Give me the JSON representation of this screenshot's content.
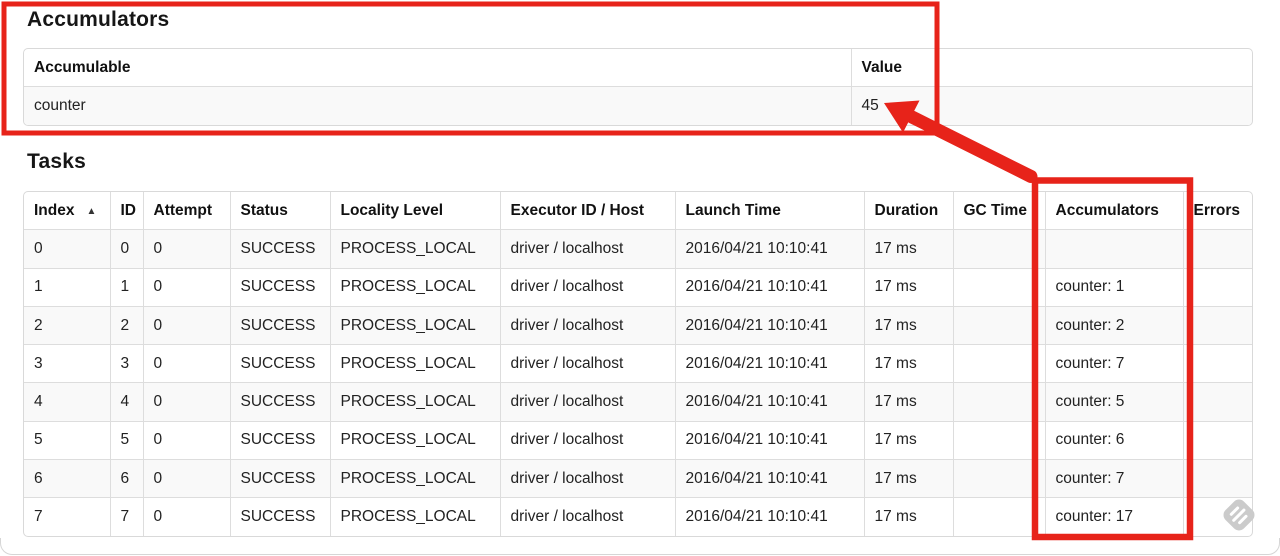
{
  "accumulators": {
    "heading": "Accumulators",
    "columns": [
      "Accumulable",
      "Value"
    ],
    "rows": [
      [
        "counter",
        "45"
      ]
    ]
  },
  "tasks": {
    "heading": "Tasks",
    "columns": [
      "Index",
      "ID",
      "Attempt",
      "Status",
      "Locality Level",
      "Executor ID / Host",
      "Launch Time",
      "Duration",
      "GC Time",
      "Accumulators",
      "Errors"
    ],
    "sort_icon": "▲",
    "sorted_column": "Index",
    "rows": [
      [
        "0",
        "0",
        "0",
        "SUCCESS",
        "PROCESS_LOCAL",
        "driver / localhost",
        "2016/04/21 10:10:41",
        "17 ms",
        "",
        "",
        ""
      ],
      [
        "1",
        "1",
        "0",
        "SUCCESS",
        "PROCESS_LOCAL",
        "driver / localhost",
        "2016/04/21 10:10:41",
        "17 ms",
        "",
        "counter: 1",
        ""
      ],
      [
        "2",
        "2",
        "0",
        "SUCCESS",
        "PROCESS_LOCAL",
        "driver / localhost",
        "2016/04/21 10:10:41",
        "17 ms",
        "",
        "counter: 2",
        ""
      ],
      [
        "3",
        "3",
        "0",
        "SUCCESS",
        "PROCESS_LOCAL",
        "driver / localhost",
        "2016/04/21 10:10:41",
        "17 ms",
        "",
        "counter: 7",
        ""
      ],
      [
        "4",
        "4",
        "0",
        "SUCCESS",
        "PROCESS_LOCAL",
        "driver / localhost",
        "2016/04/21 10:10:41",
        "17 ms",
        "",
        "counter: 5",
        ""
      ],
      [
        "5",
        "5",
        "0",
        "SUCCESS",
        "PROCESS_LOCAL",
        "driver / localhost",
        "2016/04/21 10:10:41",
        "17 ms",
        "",
        "counter: 6",
        ""
      ],
      [
        "6",
        "6",
        "0",
        "SUCCESS",
        "PROCESS_LOCAL",
        "driver / localhost",
        "2016/04/21 10:10:41",
        "17 ms",
        "",
        "counter: 7",
        ""
      ],
      [
        "7",
        "7",
        "0",
        "SUCCESS",
        "PROCESS_LOCAL",
        "driver / localhost",
        "2016/04/21 10:10:41",
        "17 ms",
        "",
        "counter: 17",
        ""
      ]
    ]
  },
  "annotations": {
    "highlight_color": "#e7231a"
  },
  "watermark": {
    "icon": "feedly-logo",
    "color": "#cbcbcb"
  }
}
